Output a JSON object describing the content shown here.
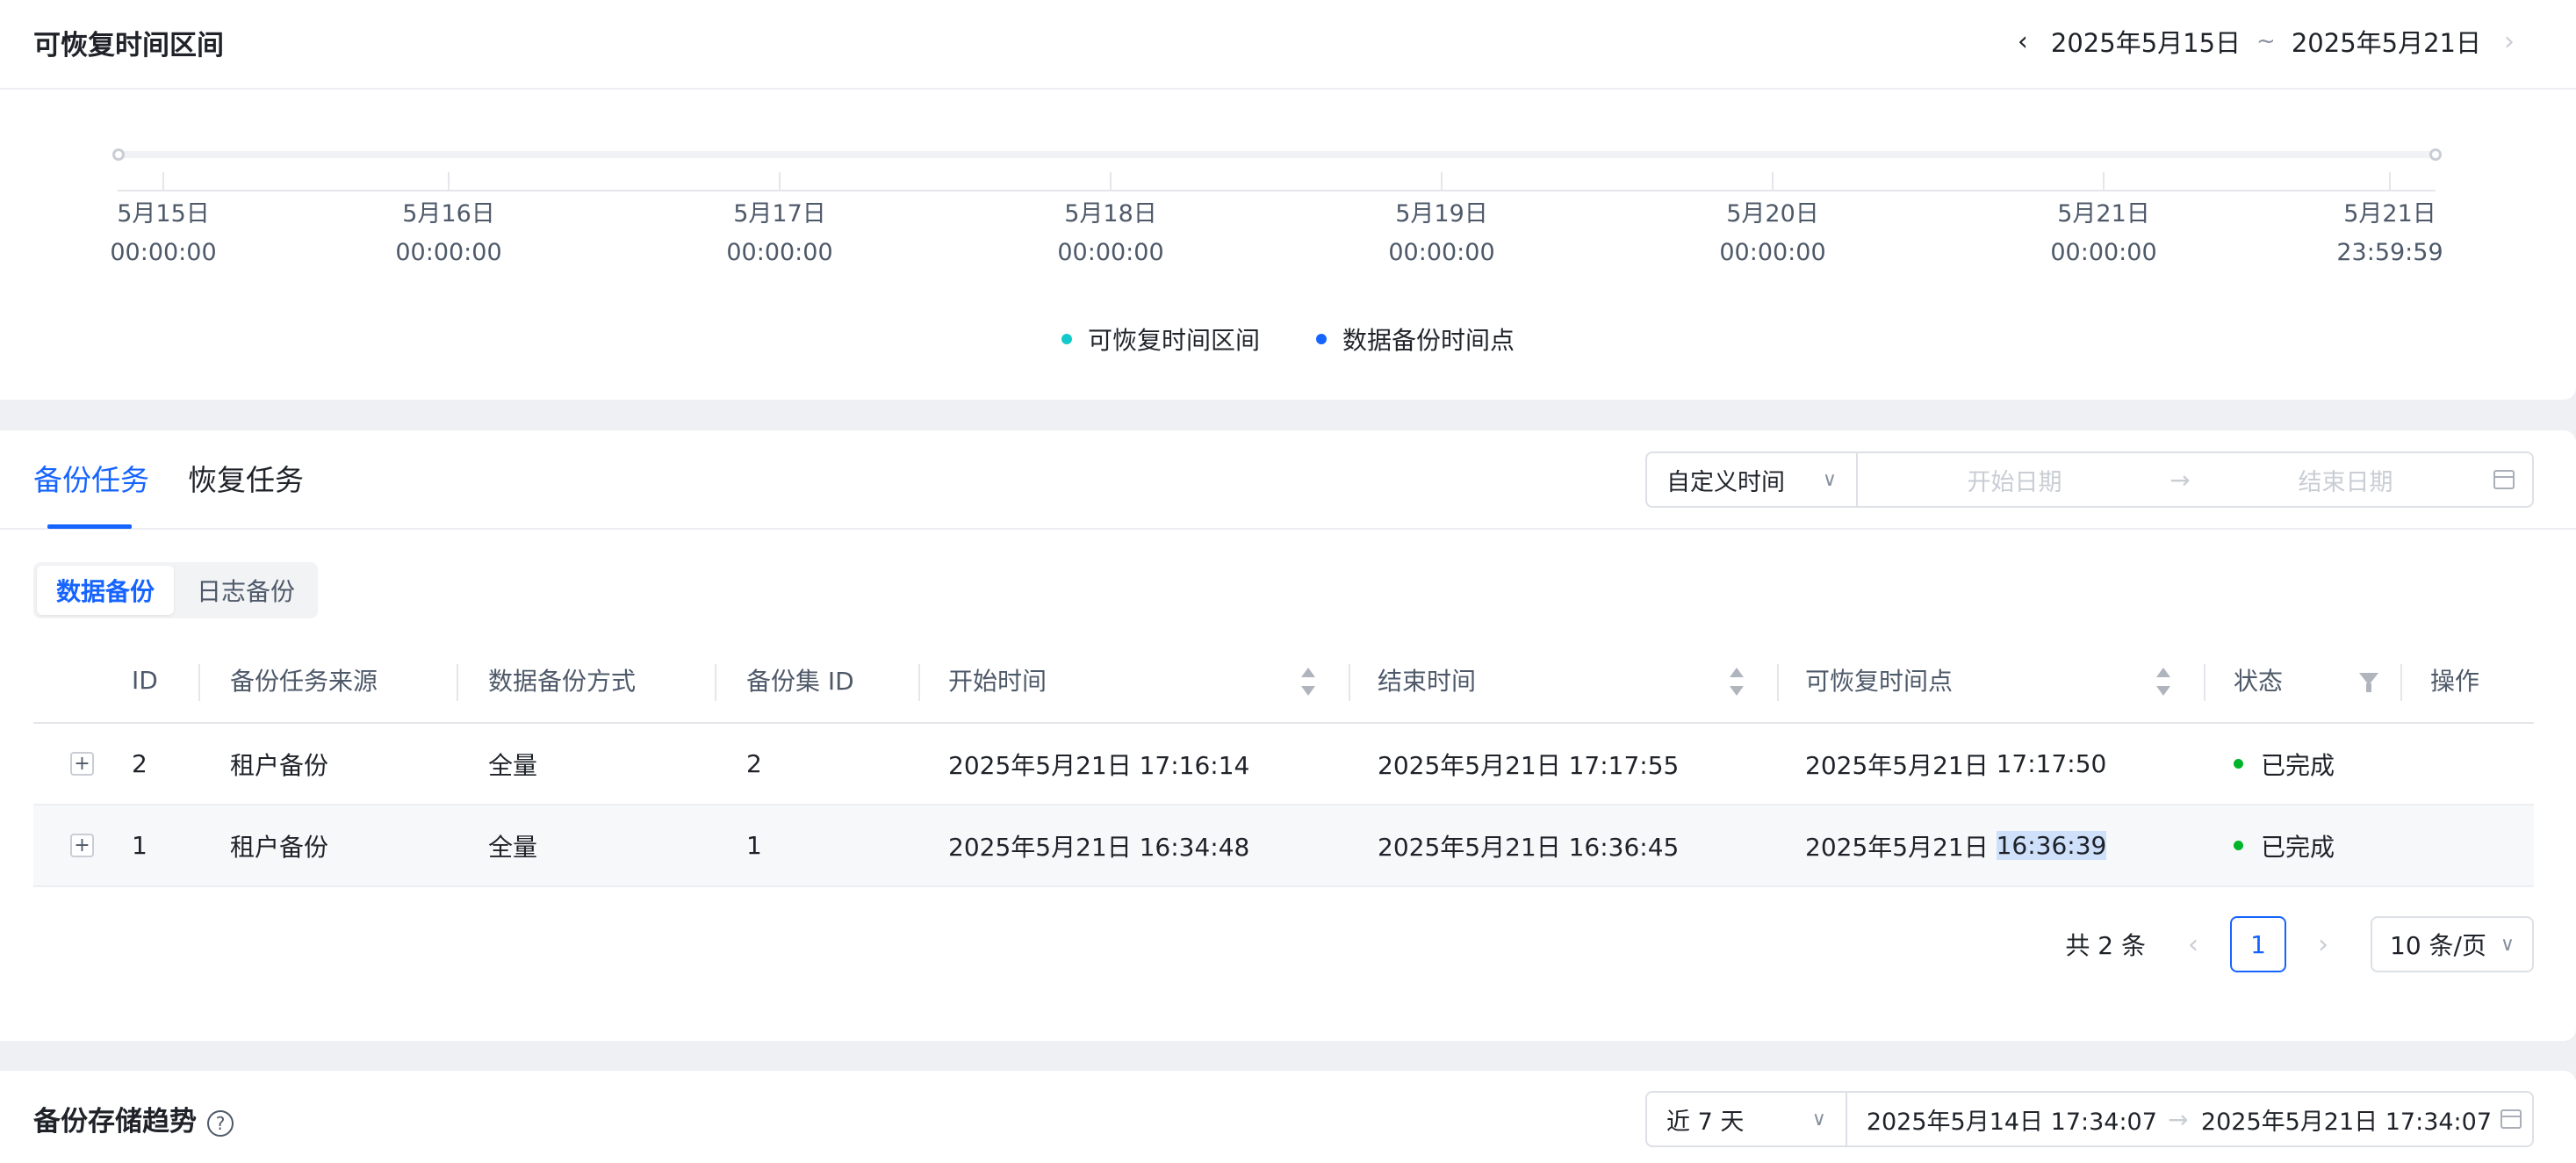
{
  "restore_range": {
    "title": "可恢复时间区间",
    "range_start": "2025年5月15日",
    "range_separator": "~",
    "range_end": "2025年5月21日",
    "prev_icon": "chevron-left-icon",
    "next_icon": "chevron-right-icon",
    "ticks": [
      {
        "date": "5月15日",
        "time": "00:00:00"
      },
      {
        "date": "5月16日",
        "time": "00:00:00"
      },
      {
        "date": "5月17日",
        "time": "00:00:00"
      },
      {
        "date": "5月18日",
        "time": "00:00:00"
      },
      {
        "date": "5月19日",
        "time": "00:00:00"
      },
      {
        "date": "5月20日",
        "time": "00:00:00"
      },
      {
        "date": "5月21日",
        "time": "00:00:00"
      },
      {
        "date": "5月21日",
        "time": "23:59:59"
      }
    ],
    "legend": [
      {
        "label": "可恢复时间区间",
        "color": "#14c9c9"
      },
      {
        "label": "数据备份时间点",
        "color": "#1664ff"
      }
    ]
  },
  "tasks": {
    "tabs": [
      "备份任务",
      "恢复任务"
    ],
    "active_tab": "备份任务",
    "date_filter": {
      "mode": "自定义时间",
      "start_placeholder": "开始日期",
      "end_placeholder": "结束日期"
    },
    "segments": [
      "数据备份",
      "日志备份"
    ],
    "active_segment": "数据备份",
    "columns": [
      "ID",
      "备份任务来源",
      "数据备份方式",
      "备份集 ID",
      "开始时间",
      "结束时间",
      "可恢复时间点",
      "状态",
      "操作"
    ],
    "rows": [
      {
        "id": "2",
        "source": "租户备份",
        "method": "全量",
        "set_id": "2",
        "start": "2025年5月21日 17:16:14",
        "end": "2025年5月21日 17:17:55",
        "restore_date": "2025年5月21日",
        "restore_time": "17:17:50",
        "status": "已完成"
      },
      {
        "id": "1",
        "source": "租户备份",
        "method": "全量",
        "set_id": "1",
        "start": "2025年5月21日 16:34:48",
        "end": "2025年5月21日 16:36:45",
        "restore_date": "2025年5月21日",
        "restore_time": "16:36:39",
        "status": "已完成"
      }
    ],
    "pagination": {
      "total_label": "共 2 条",
      "current_page": "1",
      "page_size": "10 条/页"
    },
    "colors": {
      "accent": "#1664ff",
      "status_done": "#00b42a",
      "selection": "#cfe0fb"
    }
  },
  "storage_trend": {
    "title": "备份存储趋势",
    "help_icon": "question-circle-icon",
    "range_mode": "近 7 天",
    "start": "2025年5月14日 17:34:07",
    "end": "2025年5月21日 17:34:07"
  }
}
